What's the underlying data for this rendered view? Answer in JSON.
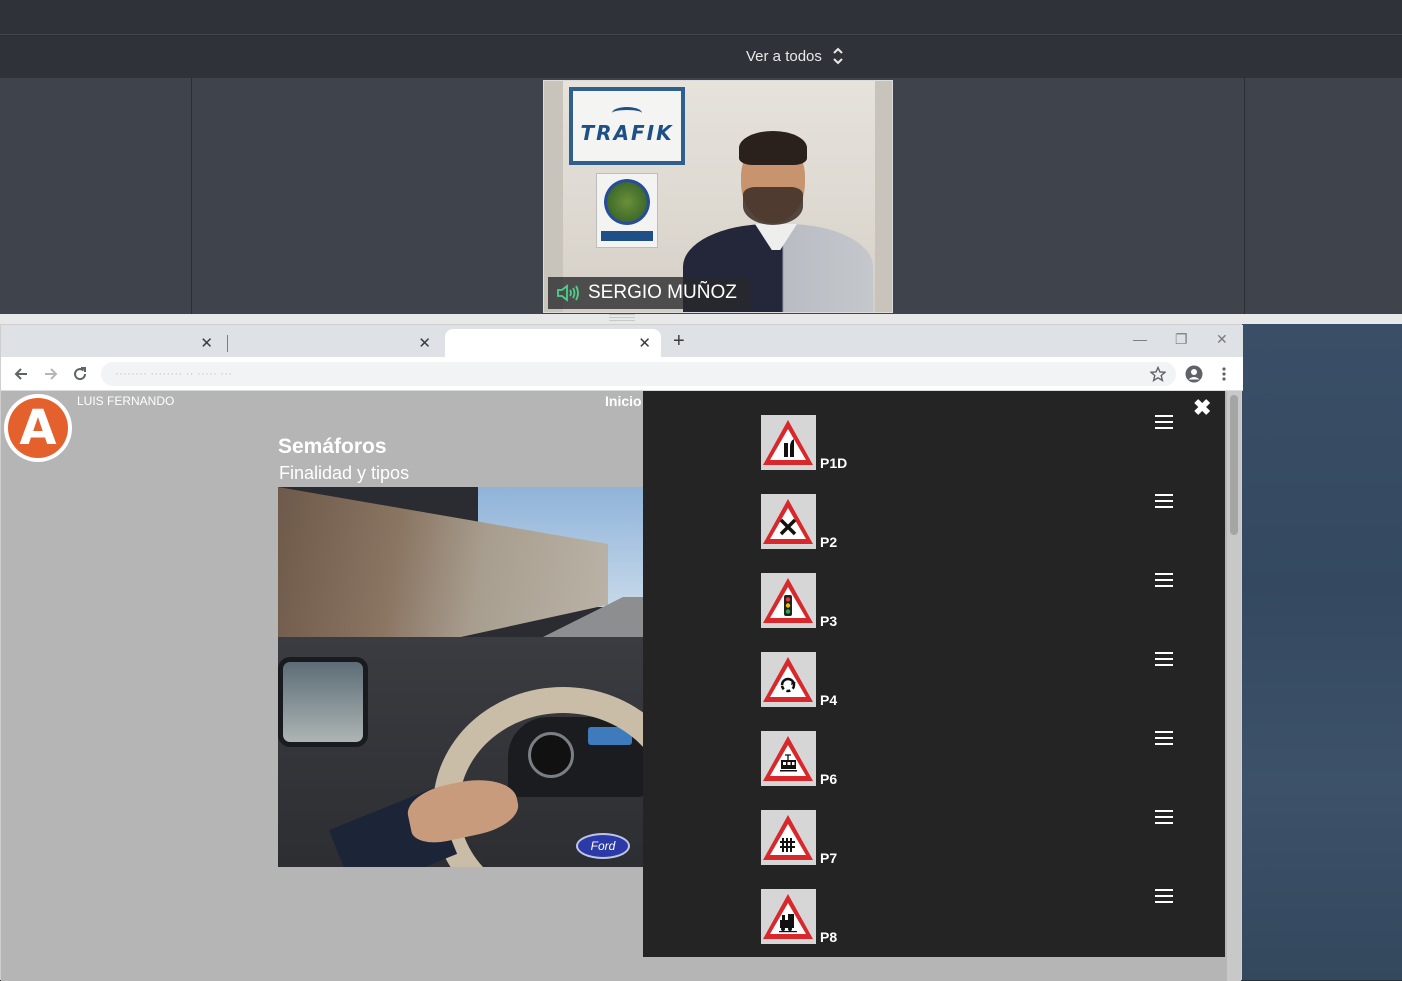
{
  "meeting": {
    "view_all_label": "Ver a todos",
    "participant_name": "SERGIO MUÑOZ",
    "poster_brand": "TRAFIK"
  },
  "browser": {
    "tabs": [
      {
        "label": ""
      },
      {
        "label": ""
      },
      {
        "label": ""
      }
    ],
    "new_tab_label": "+",
    "address": "········ ········ ·· ····· ···"
  },
  "page": {
    "user_name": "LUIS FERNANDO",
    "inicio_link": "Inicio",
    "logo_letter": "A",
    "lesson_title": "Semáforos",
    "lesson_subtitle": "Finalidad y tipos",
    "sim_brand": "Ford"
  },
  "signals": [
    {
      "code": "P1D",
      "icon": "narrowing-right-sign-icon"
    },
    {
      "code": "P2",
      "icon": "intersection-priority-sign-icon"
    },
    {
      "code": "P3",
      "icon": "traffic-light-sign-icon"
    },
    {
      "code": "P4",
      "icon": "roundabout-sign-icon"
    },
    {
      "code": "P6",
      "icon": "tram-sign-icon"
    },
    {
      "code": "P7",
      "icon": "level-crossing-gates-sign-icon"
    },
    {
      "code": "P8",
      "icon": "level-crossing-no-gates-sign-icon"
    }
  ],
  "colors": {
    "accent_orange": "#e4602c",
    "speaker_green": "#4fd08a",
    "sign_red": "#d9282b"
  }
}
